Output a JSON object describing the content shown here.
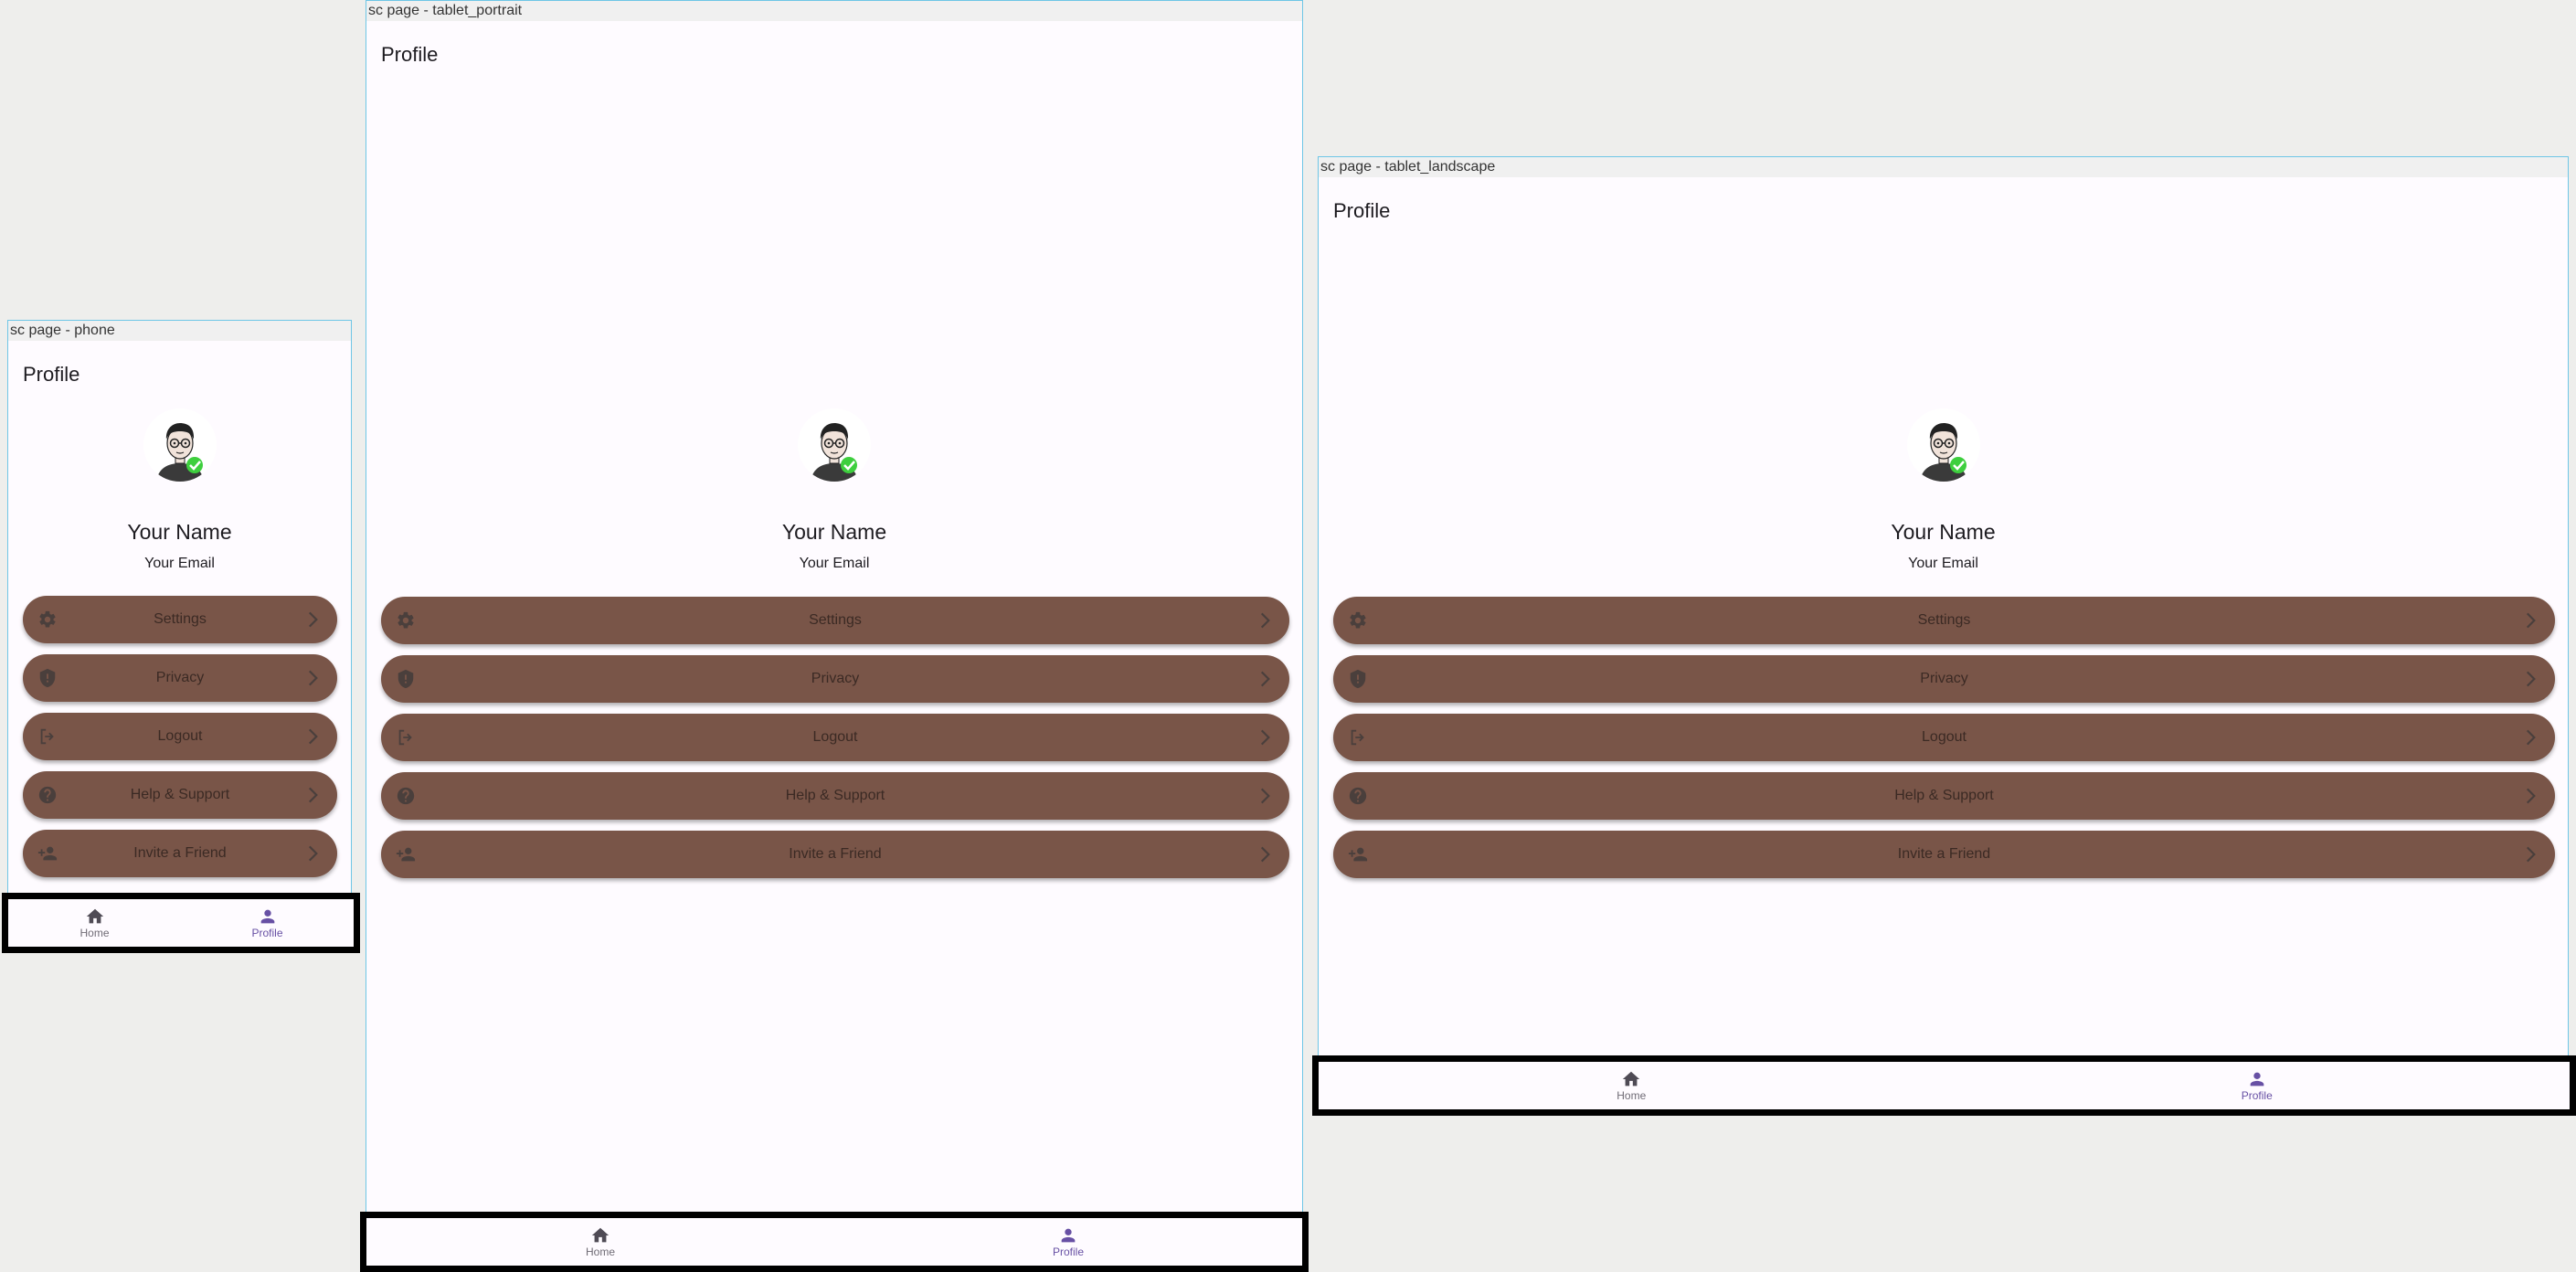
{
  "accent_color": "#6750a4",
  "button_color": "#795548",
  "devices": {
    "phone": {
      "caption": "sc page - phone",
      "title": "Profile",
      "name": "Your Name",
      "email": "Your Email",
      "menu": [
        {
          "label": "Settings",
          "icon": "gear-icon"
        },
        {
          "label": "Privacy",
          "icon": "shield-icon"
        },
        {
          "label": "Logout",
          "icon": "logout-icon"
        },
        {
          "label": "Help & Support",
          "icon": "help-icon"
        },
        {
          "label": "Invite a Friend",
          "icon": "person-add-icon"
        }
      ],
      "nav": {
        "home": "Home",
        "profile": "Profile"
      }
    },
    "tablet_portrait": {
      "caption": "sc page - tablet_portrait",
      "title": "Profile",
      "name": "Your Name",
      "email": "Your Email",
      "menu": [
        {
          "label": "Settings",
          "icon": "gear-icon"
        },
        {
          "label": "Privacy",
          "icon": "shield-icon"
        },
        {
          "label": "Logout",
          "icon": "logout-icon"
        },
        {
          "label": "Help & Support",
          "icon": "help-icon"
        },
        {
          "label": "Invite a Friend",
          "icon": "person-add-icon"
        }
      ],
      "nav": {
        "home": "Home",
        "profile": "Profile"
      }
    },
    "tablet_landscape": {
      "caption": "sc page - tablet_landscape",
      "title": "Profile",
      "name": "Your Name",
      "email": "Your Email",
      "menu": [
        {
          "label": "Settings",
          "icon": "gear-icon"
        },
        {
          "label": "Privacy",
          "icon": "shield-icon"
        },
        {
          "label": "Logout",
          "icon": "logout-icon"
        },
        {
          "label": "Help & Support",
          "icon": "help-icon"
        },
        {
          "label": "Invite a Friend",
          "icon": "person-add-icon"
        }
      ],
      "nav": {
        "home": "Home",
        "profile": "Profile"
      }
    }
  }
}
